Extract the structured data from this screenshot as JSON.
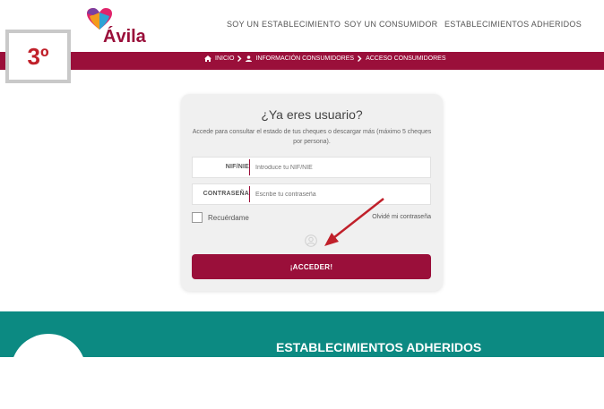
{
  "brand": {
    "logo_text": "Ávila"
  },
  "nav": {
    "items": [
      "SOY UN ESTABLECIMIENTO",
      "SOY UN CONSUMIDOR",
      "ESTABLECIMIENTOS ADHERIDOS"
    ]
  },
  "badge": {
    "label": "3º"
  },
  "breadcrumb": {
    "items": [
      "INICIO",
      "INFORMACIÓN CONSUMIDORES",
      "ACCESO CONSUMIDORES"
    ]
  },
  "login": {
    "title": "¿Ya eres usuario?",
    "subtitle": "Accede para consultar el estado de tus cheques o descargar más (máximo 5 cheques por persona).",
    "nif_label": "NIF/NIE",
    "nif_placeholder": "Introduce tu NIF/NIE",
    "password_label": "CONTRASEÑA",
    "password_placeholder": "Escribe tu contraseña",
    "remember_label": "Recuérdame",
    "forgot_label": "Olvidé mi contraseña",
    "submit_label": "¡ACCEDER!"
  },
  "footer_section": {
    "title": "ESTABLECIMIENTOS ADHERIDOS"
  },
  "colors": {
    "brand": "#9a0f3a",
    "teal": "#0c8a82",
    "annotation": "#c0202a"
  },
  "icons": [
    "heart-logo-icon",
    "home-icon",
    "chevron-right-icon",
    "person-icon",
    "user-circle-icon",
    "annotation-arrow-icon"
  ]
}
